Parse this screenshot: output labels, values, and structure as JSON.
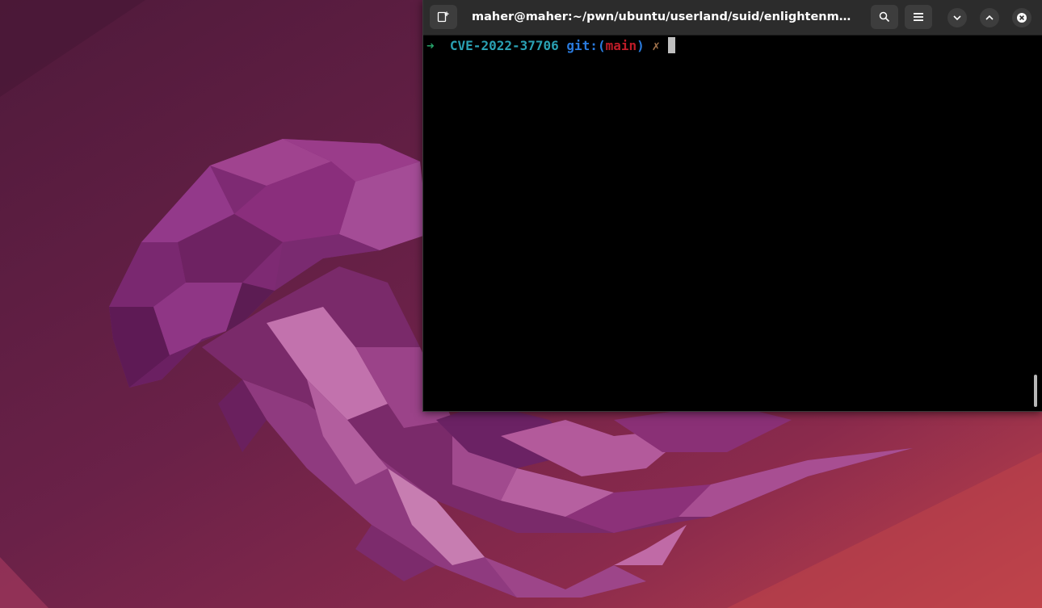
{
  "desktop": {
    "wallpaper": "jammy-jellyfish-wallpaper",
    "colors": {
      "background_dark": "#5a1e42",
      "background_light": "#c0434a",
      "jellyfish_purple": "#8e3585"
    }
  },
  "terminal": {
    "title": "maher@maher:~/pwn/ubuntu/userland/suid/enlightenment/sec/CV...",
    "headerbar": {
      "new_tab_icon": "new-tab-icon",
      "search_icon": "search-icon",
      "menu_icon": "hamburger-menu-icon",
      "minimize_icon": "chevron-down-icon",
      "maximize_icon": "chevron-up-icon",
      "close_icon": "close-icon"
    },
    "prompt": {
      "arrow": "➜",
      "directory": "CVE-2022-37706",
      "git_prefix": "git:(",
      "branch": "main",
      "git_suffix": ")",
      "dirty_mark": "✗"
    },
    "colors": {
      "background": "#000000",
      "headerbar": "#2c2c2c",
      "arrow": "#26a269",
      "directory": "#2aa1b3",
      "git": "#2a7bde",
      "branch": "#c01c28",
      "dirty": "#a2734c"
    }
  }
}
